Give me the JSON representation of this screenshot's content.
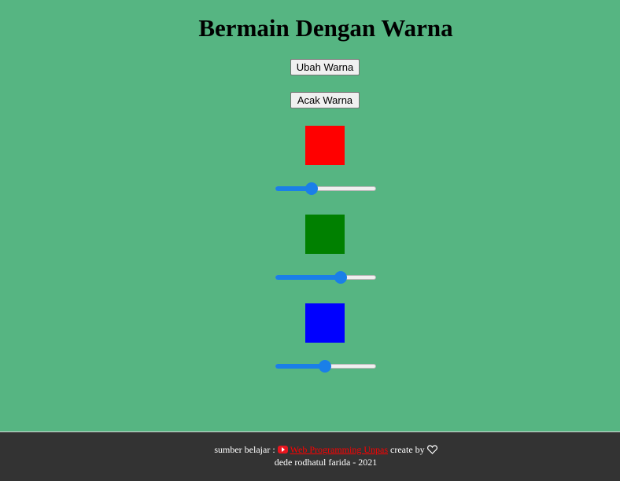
{
  "page": {
    "title": "Bermain Dengan Warna",
    "background": "#56b582"
  },
  "buttons": {
    "change_color": "Ubah Warna",
    "random_color": "Acak Warna"
  },
  "swatches": [
    {
      "name": "red",
      "color": "#ff0000"
    },
    {
      "name": "green",
      "color": "#008000"
    },
    {
      "name": "blue",
      "color": "#0000ff"
    }
  ],
  "sliders": [
    {
      "channel": "red",
      "value_fraction": 0.34
    },
    {
      "channel": "green",
      "value_fraction": 0.67
    },
    {
      "channel": "blue",
      "value_fraction": 0.49
    }
  ],
  "footer": {
    "source_prefix": "sumber belajar :",
    "icon": "youtube-icon",
    "link_text": "Web Programming Unpas",
    "create_by": "create by",
    "heart_icon": "heart-icon",
    "author_line": "dede rodhatul farida - 2021",
    "link_color": "#ff0000",
    "background": "#333333"
  }
}
